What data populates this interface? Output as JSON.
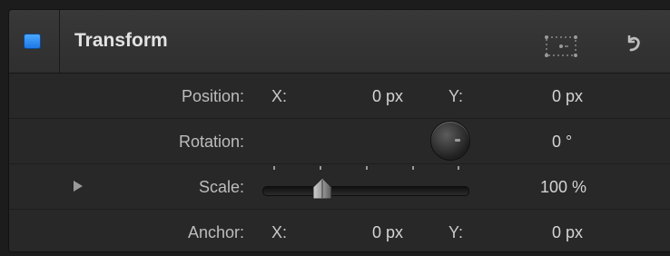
{
  "header": {
    "title": "Transform",
    "enable_color": "#2f8cf2"
  },
  "rows": {
    "position": {
      "label": "Position:",
      "x_label": "X:",
      "x_value": "0 px",
      "y_label": "Y:",
      "y_value": "0 px"
    },
    "rotation": {
      "label": "Rotation:",
      "value": "0 °"
    },
    "scale": {
      "label": "Scale:",
      "value": "100 %"
    },
    "anchor": {
      "label": "Anchor:",
      "x_label": "X:",
      "x_value": "0 px",
      "y_label": "Y:",
      "y_value": "0 px"
    }
  },
  "icons": {
    "enable": "checkbox-icon",
    "onscreen_controls": "onscreen-controls-icon",
    "reset": "reset-arrow-icon",
    "disclosure": "disclosure-triangle-icon",
    "rotation_dial": "rotation-dial-icon"
  }
}
